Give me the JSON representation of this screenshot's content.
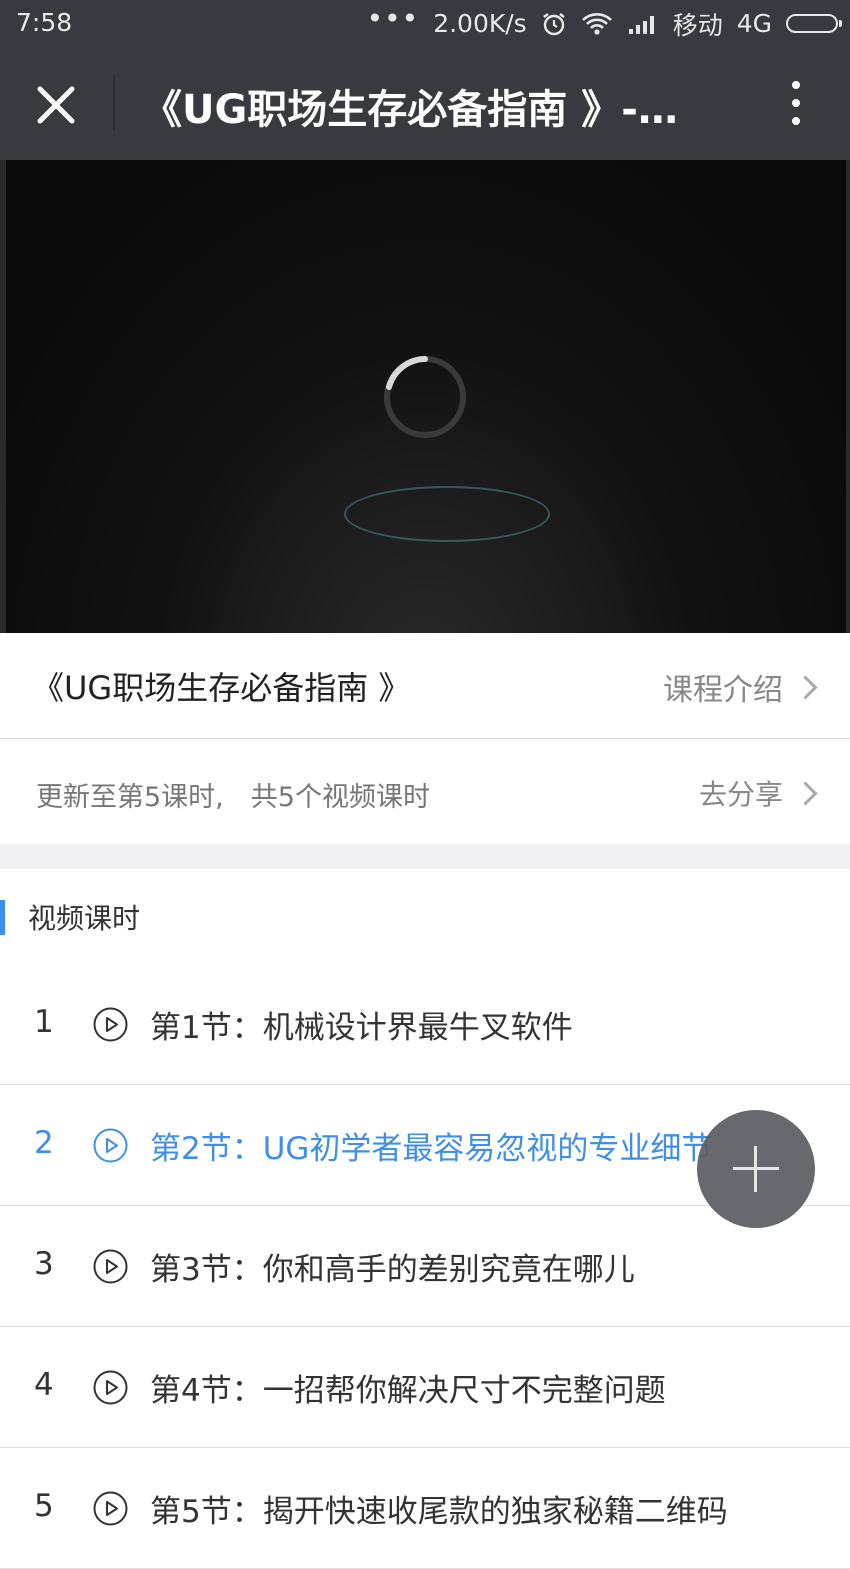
{
  "status_bar": {
    "time": "7:58",
    "dots": "•••",
    "speed": "2.00K/s",
    "carrier": "移动",
    "network": "4G",
    "icons": [
      "alarm-icon",
      "wifi-icon",
      "signal-icon",
      "battery-icon"
    ]
  },
  "app_bar": {
    "title": "《UG职场生存必备指南 》-…",
    "close_icon": "close-icon",
    "more_icon": "more-vertical-icon"
  },
  "video": {
    "state": "loading",
    "spinner_icon": "loading-spinner-icon"
  },
  "course": {
    "name": "《UG职场生存必备指南 》",
    "intro_link": "课程介绍",
    "update_info": "更新至第5课时,　共5个视频课时",
    "share_link": "去分享"
  },
  "section": {
    "title": "视频课时"
  },
  "lessons": [
    {
      "num": "1",
      "title": "第1节：机械设计界最牛叉软件",
      "active": false
    },
    {
      "num": "2",
      "title": "第2节：UG初学者最容易忽视的专业细节",
      "active": true
    },
    {
      "num": "3",
      "title": "第3节：你和高手的差别究竟在哪儿",
      "active": false
    },
    {
      "num": "4",
      "title": "第4节：一招帮你解决尺寸不完整问题",
      "active": false
    },
    {
      "num": "5",
      "title": "第5节：揭开快速收尾款的独家秘籍二维码",
      "active": false
    }
  ],
  "colors": {
    "accent": "#3f8fe6",
    "bar_bg": "#393a3f"
  },
  "fab": {
    "icon": "plus-icon"
  }
}
